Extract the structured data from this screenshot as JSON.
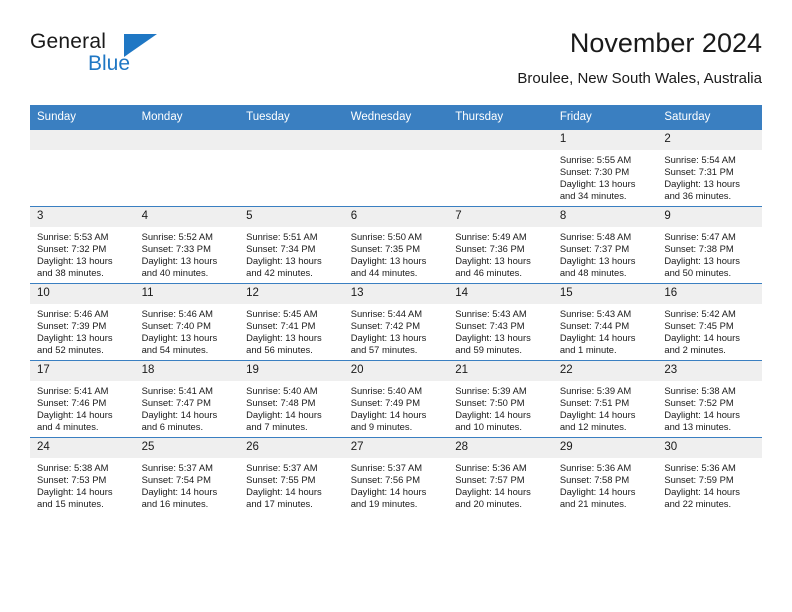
{
  "brand": {
    "name_part1": "General",
    "name_part2": "Blue",
    "accent_color": "#1f77c4"
  },
  "header": {
    "title": "November 2024",
    "subtitle": "Broulee, New South Wales, Australia"
  },
  "calendar": {
    "header_background": "#3a7fc1",
    "daynum_background": "#efefef",
    "weekdays": [
      "Sunday",
      "Monday",
      "Tuesday",
      "Wednesday",
      "Thursday",
      "Friday",
      "Saturday"
    ],
    "weeks": [
      [
        {
          "day": "",
          "empty": true
        },
        {
          "day": "",
          "empty": true
        },
        {
          "day": "",
          "empty": true
        },
        {
          "day": "",
          "empty": true
        },
        {
          "day": "",
          "empty": true
        },
        {
          "day": "1",
          "sunrise": "Sunrise: 5:55 AM",
          "sunset": "Sunset: 7:30 PM",
          "daylight": "Daylight: 13 hours and 34 minutes."
        },
        {
          "day": "2",
          "sunrise": "Sunrise: 5:54 AM",
          "sunset": "Sunset: 7:31 PM",
          "daylight": "Daylight: 13 hours and 36 minutes."
        }
      ],
      [
        {
          "day": "3",
          "sunrise": "Sunrise: 5:53 AM",
          "sunset": "Sunset: 7:32 PM",
          "daylight": "Daylight: 13 hours and 38 minutes."
        },
        {
          "day": "4",
          "sunrise": "Sunrise: 5:52 AM",
          "sunset": "Sunset: 7:33 PM",
          "daylight": "Daylight: 13 hours and 40 minutes."
        },
        {
          "day": "5",
          "sunrise": "Sunrise: 5:51 AM",
          "sunset": "Sunset: 7:34 PM",
          "daylight": "Daylight: 13 hours and 42 minutes."
        },
        {
          "day": "6",
          "sunrise": "Sunrise: 5:50 AM",
          "sunset": "Sunset: 7:35 PM",
          "daylight": "Daylight: 13 hours and 44 minutes."
        },
        {
          "day": "7",
          "sunrise": "Sunrise: 5:49 AM",
          "sunset": "Sunset: 7:36 PM",
          "daylight": "Daylight: 13 hours and 46 minutes."
        },
        {
          "day": "8",
          "sunrise": "Sunrise: 5:48 AM",
          "sunset": "Sunset: 7:37 PM",
          "daylight": "Daylight: 13 hours and 48 minutes."
        },
        {
          "day": "9",
          "sunrise": "Sunrise: 5:47 AM",
          "sunset": "Sunset: 7:38 PM",
          "daylight": "Daylight: 13 hours and 50 minutes."
        }
      ],
      [
        {
          "day": "10",
          "sunrise": "Sunrise: 5:46 AM",
          "sunset": "Sunset: 7:39 PM",
          "daylight": "Daylight: 13 hours and 52 minutes."
        },
        {
          "day": "11",
          "sunrise": "Sunrise: 5:46 AM",
          "sunset": "Sunset: 7:40 PM",
          "daylight": "Daylight: 13 hours and 54 minutes."
        },
        {
          "day": "12",
          "sunrise": "Sunrise: 5:45 AM",
          "sunset": "Sunset: 7:41 PM",
          "daylight": "Daylight: 13 hours and 56 minutes."
        },
        {
          "day": "13",
          "sunrise": "Sunrise: 5:44 AM",
          "sunset": "Sunset: 7:42 PM",
          "daylight": "Daylight: 13 hours and 57 minutes."
        },
        {
          "day": "14",
          "sunrise": "Sunrise: 5:43 AM",
          "sunset": "Sunset: 7:43 PM",
          "daylight": "Daylight: 13 hours and 59 minutes."
        },
        {
          "day": "15",
          "sunrise": "Sunrise: 5:43 AM",
          "sunset": "Sunset: 7:44 PM",
          "daylight": "Daylight: 14 hours and 1 minute."
        },
        {
          "day": "16",
          "sunrise": "Sunrise: 5:42 AM",
          "sunset": "Sunset: 7:45 PM",
          "daylight": "Daylight: 14 hours and 2 minutes."
        }
      ],
      [
        {
          "day": "17",
          "sunrise": "Sunrise: 5:41 AM",
          "sunset": "Sunset: 7:46 PM",
          "daylight": "Daylight: 14 hours and 4 minutes."
        },
        {
          "day": "18",
          "sunrise": "Sunrise: 5:41 AM",
          "sunset": "Sunset: 7:47 PM",
          "daylight": "Daylight: 14 hours and 6 minutes."
        },
        {
          "day": "19",
          "sunrise": "Sunrise: 5:40 AM",
          "sunset": "Sunset: 7:48 PM",
          "daylight": "Daylight: 14 hours and 7 minutes."
        },
        {
          "day": "20",
          "sunrise": "Sunrise: 5:40 AM",
          "sunset": "Sunset: 7:49 PM",
          "daylight": "Daylight: 14 hours and 9 minutes."
        },
        {
          "day": "21",
          "sunrise": "Sunrise: 5:39 AM",
          "sunset": "Sunset: 7:50 PM",
          "daylight": "Daylight: 14 hours and 10 minutes."
        },
        {
          "day": "22",
          "sunrise": "Sunrise: 5:39 AM",
          "sunset": "Sunset: 7:51 PM",
          "daylight": "Daylight: 14 hours and 12 minutes."
        },
        {
          "day": "23",
          "sunrise": "Sunrise: 5:38 AM",
          "sunset": "Sunset: 7:52 PM",
          "daylight": "Daylight: 14 hours and 13 minutes."
        }
      ],
      [
        {
          "day": "24",
          "sunrise": "Sunrise: 5:38 AM",
          "sunset": "Sunset: 7:53 PM",
          "daylight": "Daylight: 14 hours and 15 minutes."
        },
        {
          "day": "25",
          "sunrise": "Sunrise: 5:37 AM",
          "sunset": "Sunset: 7:54 PM",
          "daylight": "Daylight: 14 hours and 16 minutes."
        },
        {
          "day": "26",
          "sunrise": "Sunrise: 5:37 AM",
          "sunset": "Sunset: 7:55 PM",
          "daylight": "Daylight: 14 hours and 17 minutes."
        },
        {
          "day": "27",
          "sunrise": "Sunrise: 5:37 AM",
          "sunset": "Sunset: 7:56 PM",
          "daylight": "Daylight: 14 hours and 19 minutes."
        },
        {
          "day": "28",
          "sunrise": "Sunrise: 5:36 AM",
          "sunset": "Sunset: 7:57 PM",
          "daylight": "Daylight: 14 hours and 20 minutes."
        },
        {
          "day": "29",
          "sunrise": "Sunrise: 5:36 AM",
          "sunset": "Sunset: 7:58 PM",
          "daylight": "Daylight: 14 hours and 21 minutes."
        },
        {
          "day": "30",
          "sunrise": "Sunrise: 5:36 AM",
          "sunset": "Sunset: 7:59 PM",
          "daylight": "Daylight: 14 hours and 22 minutes."
        }
      ]
    ]
  }
}
